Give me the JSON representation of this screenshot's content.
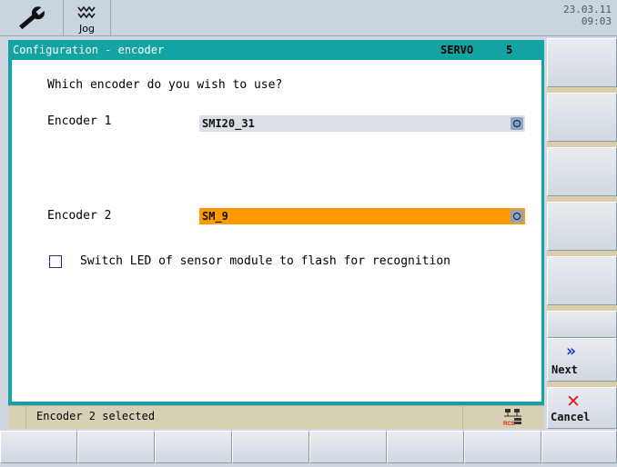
{
  "header": {
    "mode_label": "Jog",
    "date": "23.03.11",
    "time": "09:03"
  },
  "dialog": {
    "title": "Configuration - encoder",
    "servo_label": "SERVO",
    "servo_number": "5",
    "question": "Which encoder do you wish to use?",
    "encoder1": {
      "label": "Encoder 1",
      "value": "SMI20_31"
    },
    "encoder2": {
      "label": "Encoder 2",
      "value": "SM_9"
    },
    "led_checkbox": {
      "label": "Switch LED of sensor module to flash for recognition",
      "checked": false
    }
  },
  "status": {
    "message": "Encoder 2 selected",
    "icon": "rcs-network-icon"
  },
  "softkeys": {
    "next_label": "Next",
    "cancel_label": "Cancel"
  },
  "colors": {
    "dialog_frame": "#14a3a3",
    "field_selected": "#ff9a00",
    "field_normal": "#dcdfe6",
    "next_arrow": "#1b2fc9",
    "cancel_x": "#e01a1a"
  }
}
